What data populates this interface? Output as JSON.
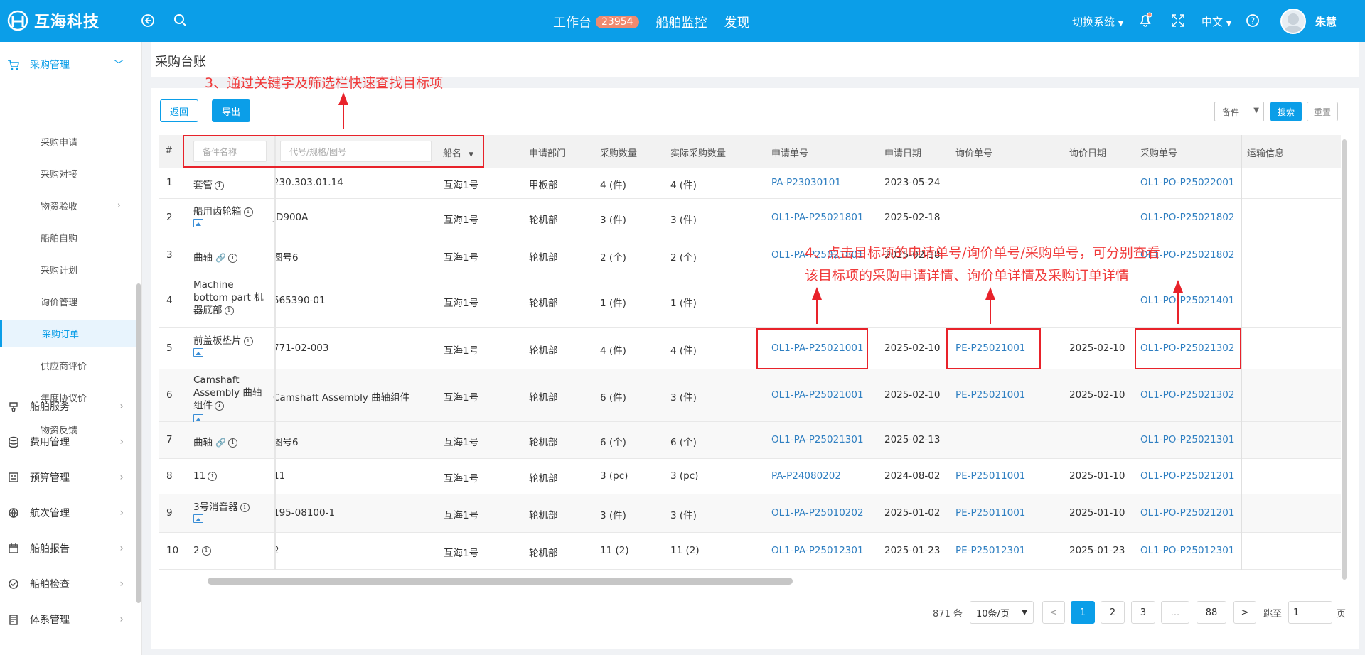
{
  "header": {
    "logo_text": "互海科技",
    "nav": [
      {
        "label": "工作台",
        "badge": "23954"
      },
      {
        "label": "船舶监控"
      },
      {
        "label": "发现"
      }
    ],
    "switch_system": "切换系统",
    "language": "中文",
    "user_name": "朱慧"
  },
  "sidebar": {
    "top_group": "采购管理",
    "sub_items": [
      "采购申请",
      "采购对接",
      "物资验收",
      "船舶自购",
      "采购计划",
      "询价管理",
      "采购订单",
      "供应商评价",
      "年度协议价",
      "物资反馈"
    ],
    "active_index": 6,
    "groups": [
      "船舶服务",
      "费用管理",
      "预算管理",
      "航次管理",
      "船舶报告",
      "船舶检查",
      "体系管理"
    ]
  },
  "page": {
    "title": "采购台账",
    "back_label": "返回",
    "export_label": "导出",
    "filter_select": "备件",
    "search_label": "搜索",
    "reset_label": "重置"
  },
  "table": {
    "headers": {
      "index": "#",
      "part_name_placeholder": "备件名称",
      "code_placeholder": "代号/规格/图号",
      "ship": "船名",
      "dept": "申请部门",
      "qty": "采购数量",
      "actual_qty": "实际采购数量",
      "apply_no": "申请单号",
      "apply_date": "申请日期",
      "inquiry_no": "询价单号",
      "inquiry_date": "询价日期",
      "po_no": "采购单号",
      "transport": "运输信息"
    },
    "rows": [
      {
        "idx": "1",
        "name": "套管",
        "code": "230.303.01.14",
        "ship": "互海1号",
        "dept": "甲板部",
        "qty": "4 (件)",
        "actual": "4 (件)",
        "apply_no": "PA-P23030101",
        "apply_date": "2023-05-24",
        "inquiry_no": "",
        "inquiry_date": "",
        "po_no": "OL1-PO-P25022001"
      },
      {
        "idx": "2",
        "name": "船用齿轮箱",
        "code": "JD900A",
        "ship": "互海1号",
        "dept": "轮机部",
        "qty": "3 (件)",
        "actual": "3 (件)",
        "apply_no": "OL1-PA-P25021801",
        "apply_date": "2025-02-18",
        "inquiry_no": "",
        "inquiry_date": "",
        "po_no": "OL1-PO-P25021802"
      },
      {
        "idx": "3",
        "name": "曲轴",
        "code": "图号6",
        "ship": "互海1号",
        "dept": "轮机部",
        "qty": "2 (个)",
        "actual": "2 (个)",
        "apply_no": "OL1-PA-P25021801",
        "apply_date": "2025-02-18",
        "inquiry_no": "",
        "inquiry_date": "",
        "po_no": "OL1-PO-P25021802"
      },
      {
        "idx": "4",
        "name": "Machine bottom part 机器底部",
        "code": "565390-01",
        "ship": "互海1号",
        "dept": "轮机部",
        "qty": "1 (件)",
        "actual": "1 (件)",
        "apply_no": "",
        "apply_date": "",
        "inquiry_no": "",
        "inquiry_date": "",
        "po_no": "OL1-PO-P25021401"
      },
      {
        "idx": "5",
        "name": "前盖板垫片",
        "code": "771-02-003",
        "ship": "互海1号",
        "dept": "轮机部",
        "qty": "4 (件)",
        "actual": "4 (件)",
        "apply_no": "OL1-PA-P25021001",
        "apply_date": "2025-02-10",
        "inquiry_no": "PE-P25021001",
        "inquiry_date": "2025-02-10",
        "po_no": "OL1-PO-P25021302"
      },
      {
        "idx": "6",
        "name": "Camshaft Assembly 曲轴组件",
        "code": "Camshaft Assembly 曲轴组件",
        "ship": "互海1号",
        "dept": "轮机部",
        "qty": "6 (件)",
        "actual": "3 (件)",
        "apply_no": "OL1-PA-P25021001",
        "apply_date": "2025-02-10",
        "inquiry_no": "PE-P25021001",
        "inquiry_date": "2025-02-10",
        "po_no": "OL1-PO-P25021302"
      },
      {
        "idx": "7",
        "name": "曲轴",
        "code": "图号6",
        "ship": "互海1号",
        "dept": "轮机部",
        "qty": "6 (个)",
        "actual": "6 (个)",
        "apply_no": "OL1-PA-P25021301",
        "apply_date": "2025-02-13",
        "inquiry_no": "",
        "inquiry_date": "",
        "po_no": "OL1-PO-P25021301"
      },
      {
        "idx": "8",
        "name": "11",
        "code": "11",
        "ship": "互海1号",
        "dept": "轮机部",
        "qty": "3 (pc)",
        "actual": "3 (pc)",
        "apply_no": "PA-P24080202",
        "apply_date": "2024-08-02",
        "inquiry_no": "PE-P25011001",
        "inquiry_date": "2025-01-10",
        "po_no": "OL1-PO-P25021201"
      },
      {
        "idx": "9",
        "name": "3号消音器",
        "code": "195-08100-1",
        "ship": "互海1号",
        "dept": "轮机部",
        "qty": "3 (件)",
        "actual": "3 (件)",
        "apply_no": "OL1-PA-P25010202",
        "apply_date": "2025-01-02",
        "inquiry_no": "PE-P25011001",
        "inquiry_date": "2025-01-10",
        "po_no": "OL1-PO-P25021201"
      },
      {
        "idx": "10",
        "name": "2",
        "code": "2",
        "ship": "互海1号",
        "dept": "轮机部",
        "qty": "11 (2)",
        "actual": "11 (2)",
        "apply_no": "OL1-PA-P25012301",
        "apply_date": "2025-01-23",
        "inquiry_no": "PE-P25012301",
        "inquiry_date": "2025-01-23",
        "po_no": "OL1-PO-P25012301"
      }
    ]
  },
  "pagination": {
    "total": "871 条",
    "page_size": "10条/页",
    "prev": "<",
    "next": ">",
    "pages": [
      "1",
      "2",
      "3",
      "...",
      "88"
    ],
    "current": "1",
    "jump_label": "跳至",
    "jump_value": "1",
    "page_suffix": "页"
  },
  "annotations": {
    "step3": "3、通过关键字及筛选栏快速查找目标项",
    "step4_line1": "4、点击目标项的申请单号/询价单号/采购单号，可分别查看",
    "step4_line2": "该目标项的采购申请详情、询价单详情及采购订单详情"
  },
  "colors": {
    "brand": "#0b9ee8",
    "link": "#2f7fc1",
    "annotation": "#e8222a"
  }
}
